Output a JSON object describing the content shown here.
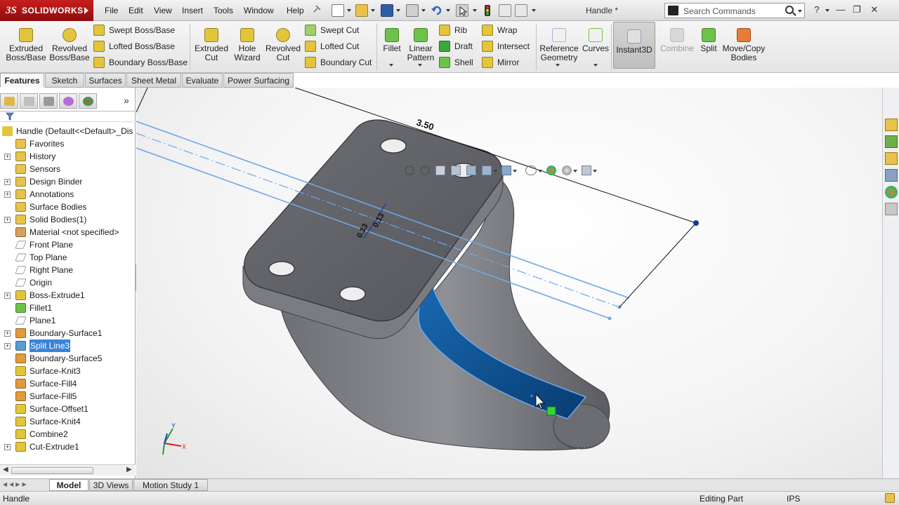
{
  "app": {
    "logo_text": "SOLIDWORKS",
    "document_title": "Handle *",
    "menus": [
      "File",
      "Edit",
      "View",
      "Insert",
      "Tools",
      "Window",
      "Help"
    ]
  },
  "search": {
    "placeholder": "Search Commands"
  },
  "command_manager": {
    "extruded_boss": "Extruded\nBoss/Base",
    "revolved_boss": "Revolved\nBoss/Base",
    "swept_boss": "Swept Boss/Base",
    "lofted_boss": "Lofted Boss/Base",
    "boundary_boss": "Boundary Boss/Base",
    "extruded_cut": "Extruded\nCut",
    "hole_wizard": "Hole\nWizard",
    "revolved_cut": "Revolved\nCut",
    "swept_cut": "Swept Cut",
    "lofted_cut": "Lofted Cut",
    "boundary_cut": "Boundary Cut",
    "fillet": "Fillet",
    "linear_pattern": "Linear\nPattern",
    "rib": "Rib",
    "draft": "Draft",
    "shell": "Shell",
    "wrap": "Wrap",
    "intersect": "Intersect",
    "mirror": "Mirror",
    "reference_geometry": "Reference\nGeometry",
    "curves": "Curves",
    "instant3d": "Instant3D",
    "combine": "Combine",
    "split": "Split",
    "move_copy": "Move/Copy\nBodies"
  },
  "tabs": [
    "Features",
    "Sketch",
    "Surfaces",
    "Sheet Metal",
    "Evaluate",
    "Power Surfacing"
  ],
  "active_tab": "Features",
  "feature_tree": {
    "root": "Handle  (Default<<Default>_Dis",
    "items": [
      {
        "label": "Favorites",
        "icon": "favorites-folder-icon",
        "expandable": false
      },
      {
        "label": "History",
        "icon": "history-icon",
        "expandable": true
      },
      {
        "label": "Sensors",
        "icon": "sensors-folder-icon",
        "expandable": false
      },
      {
        "label": "Design Binder",
        "icon": "design-binder-icon",
        "expandable": true
      },
      {
        "label": "Annotations",
        "icon": "annotations-icon",
        "expandable": true
      },
      {
        "label": "Surface Bodies",
        "icon": "surface-bodies-folder-icon",
        "expandable": false
      },
      {
        "label": "Solid Bodies(1)",
        "icon": "solid-bodies-folder-icon",
        "expandable": true
      },
      {
        "label": "Material <not specified>",
        "icon": "material-icon",
        "expandable": false
      },
      {
        "label": "Front Plane",
        "icon": "plane-icon",
        "expandable": false
      },
      {
        "label": "Top Plane",
        "icon": "plane-icon",
        "expandable": false
      },
      {
        "label": "Right Plane",
        "icon": "plane-icon",
        "expandable": false
      },
      {
        "label": "Origin",
        "icon": "origin-icon",
        "expandable": false
      },
      {
        "label": "Boss-Extrude1",
        "icon": "boss-extrude-icon",
        "expandable": true
      },
      {
        "label": "Fillet1",
        "icon": "fillet-icon",
        "expandable": false
      },
      {
        "label": "Plane1",
        "icon": "plane-icon",
        "expandable": false
      },
      {
        "label": "Boundary-Surface1",
        "icon": "boundary-surface-icon",
        "expandable": true
      },
      {
        "label": "Split Line3",
        "icon": "split-line-icon",
        "expandable": true,
        "selected": true
      },
      {
        "label": "Boundary-Surface5",
        "icon": "boundary-surface-icon",
        "expandable": false
      },
      {
        "label": "Surface-Knit3",
        "icon": "surface-knit-icon",
        "expandable": false
      },
      {
        "label": "Surface-Fill4",
        "icon": "surface-fill-icon",
        "expandable": false
      },
      {
        "label": "Surface-Fill5",
        "icon": "surface-fill-icon",
        "expandable": false
      },
      {
        "label": "Surface-Offset1",
        "icon": "surface-offset-icon",
        "expandable": false
      },
      {
        "label": "Surface-Knit4",
        "icon": "surface-knit-icon",
        "expandable": false
      },
      {
        "label": "Combine2",
        "icon": "combine-icon",
        "expandable": false
      },
      {
        "label": "Cut-Extrude1",
        "icon": "cut-extrude-icon",
        "expandable": true
      }
    ]
  },
  "viewport": {
    "dimension_length": "3.50",
    "dimension_offset_a": "0.13",
    "dimension_offset_b": "0.13",
    "triad": {
      "y": "Y",
      "x": "X"
    }
  },
  "bottom_tabs": [
    "Model",
    "3D Views",
    "Motion Study 1"
  ],
  "active_bottom_tab": "Model",
  "status": {
    "left": "Handle",
    "mode": "Editing Part",
    "units": "IPS"
  },
  "colors": {
    "accent": "#3a84d8",
    "brand": "#c81e1e",
    "body": "#5d5f63",
    "surface_highlight": "#0b4d8c",
    "sketch_line": "#6ea8e8"
  }
}
